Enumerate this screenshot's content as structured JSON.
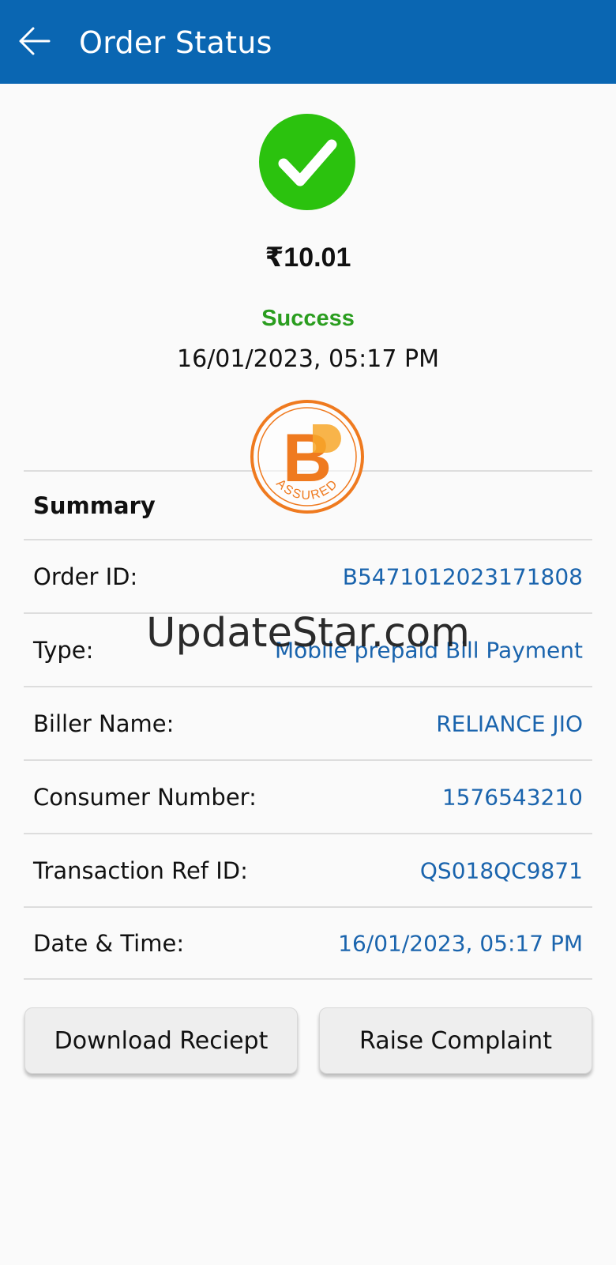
{
  "header": {
    "title": "Order Status",
    "back_icon": "arrow-left-icon",
    "background": "#0a66b2"
  },
  "status": {
    "icon": "check-circle-icon",
    "icon_color": "#2bc20e",
    "amount": "₹10.01",
    "label": "Success",
    "label_color": "#2a9d1f",
    "datetime": "16/01/2023, 05:17 PM"
  },
  "badge": {
    "icon": "bbps-assured-logo",
    "letter": "B",
    "text": "ASSURED",
    "color": "#ef7a1f"
  },
  "summary": {
    "heading": "Summary",
    "rows": [
      {
        "label": "Order ID:",
        "value": "B5471012023171808"
      },
      {
        "label": "Type:",
        "value": "Mobile prepaid Bill Payment"
      },
      {
        "label": "Biller Name:",
        "value": "RELIANCE JIO"
      },
      {
        "label": "Consumer Number:",
        "value": "1576543210"
      },
      {
        "label": "Transaction Ref ID:",
        "value": "QS018QC9871"
      },
      {
        "label": "Date & Time:",
        "value": "16/01/2023, 05:17 PM"
      }
    ]
  },
  "actions": {
    "download_label": "Download Reciept",
    "complaint_label": "Raise Complaint"
  },
  "watermark": {
    "text": "UpdateStar.com"
  }
}
